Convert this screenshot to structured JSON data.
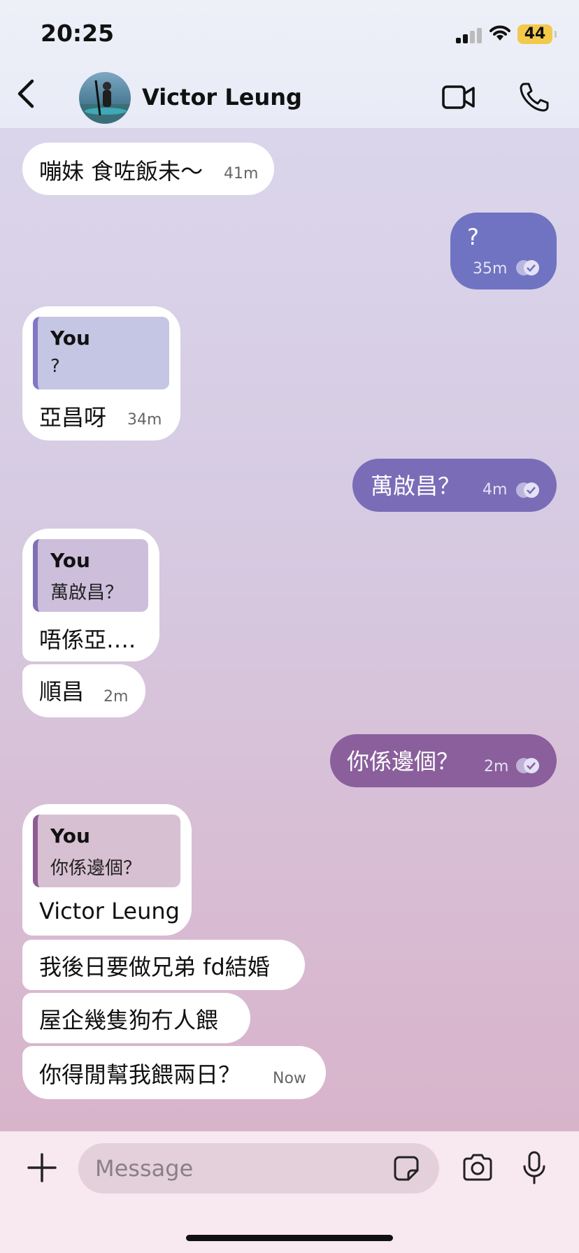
{
  "status_bar": {
    "time": "20:25",
    "battery": "44"
  },
  "header": {
    "contact_name": "Victor Leung"
  },
  "messages": [
    {
      "dir": "in",
      "text": "嘣妹 食咗飯未～",
      "time": "41m"
    },
    {
      "dir": "out",
      "text": "?",
      "time": "35m"
    },
    {
      "dir": "in",
      "quote_author": "You",
      "quote_text": "?",
      "text": "亞昌呀",
      "time": "34m"
    },
    {
      "dir": "out",
      "text": "萬啟昌？",
      "time": "4m"
    },
    {
      "dir": "in",
      "quote_author": "You",
      "quote_text": "萬啟昌？",
      "text": "唔係亞…."
    },
    {
      "dir": "in",
      "text": "順昌",
      "time": "2m"
    },
    {
      "dir": "out",
      "text": "你係邊個？",
      "time": "2m"
    },
    {
      "dir": "in",
      "quote_author": "You",
      "quote_text": "你係邊個？",
      "text": "Victor Leung"
    },
    {
      "dir": "in",
      "text": "我後日要做兄弟 fd結婚"
    },
    {
      "dir": "in",
      "text": "屋企幾隻狗冇人餵"
    },
    {
      "dir": "in",
      "text": "你得閒幫我餵兩日？",
      "time": "Now"
    }
  ],
  "composer": {
    "placeholder": "Message"
  },
  "colors": {
    "out_bubble_1": "#6f73c2",
    "out_bubble_2": "#7a6cb7",
    "out_bubble_3": "#8a5f9c",
    "incoming": "#ffffff"
  }
}
